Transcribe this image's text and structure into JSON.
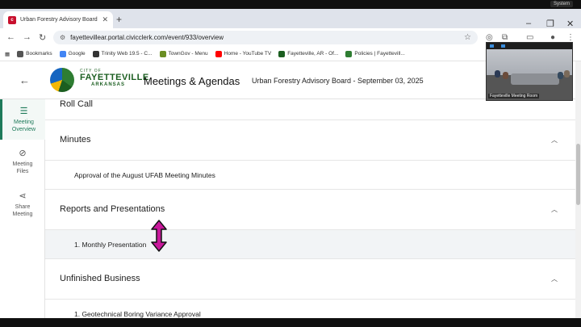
{
  "os": {
    "system_label": "System"
  },
  "browser": {
    "tab_title": "Urban Forestry Advisory Board",
    "url": "fayettevillear.portal.civicclerk.com/event/933/overview",
    "bookmarks": [
      {
        "label": "Bookmarks",
        "color": "#555555"
      },
      {
        "label": "Google",
        "color": "#4285f4"
      },
      {
        "label": "Trinity Web 19.5 - C...",
        "color": "#333333"
      },
      {
        "label": "TownGov - Menu",
        "color": "#6b8e23"
      },
      {
        "label": "Home - YouTube TV",
        "color": "#ff0000"
      },
      {
        "label": "Fayetteville, AR - Of...",
        "color": "#1b5e20"
      },
      {
        "label": "Policies | Fayettevill...",
        "color": "#2e7d32"
      }
    ]
  },
  "header": {
    "city_line1": "CITY OF",
    "city_line2": "FAYETTEVILLE",
    "city_line3": "ARKANSAS",
    "title": "Meetings & Agendas",
    "subtitle": "Urban Forestry Advisory Board - September 03, 2025"
  },
  "sidebar": {
    "items": [
      {
        "label1": "Meeting",
        "label2": "Overview"
      },
      {
        "label1": "Meeting",
        "label2": "Files"
      },
      {
        "label1": "Share",
        "label2": "Meeting"
      }
    ]
  },
  "agenda": {
    "roll_call": "Roll Call",
    "minutes": {
      "title": "Minutes",
      "item": "Approval of the August UFAB Meeting Minutes"
    },
    "reports": {
      "title": "Reports and Presentations",
      "item": "1. Monthly Presentation"
    },
    "unfinished": {
      "title": "Unfinished Business",
      "item": "1. Geotechnical Boring Variance Approval"
    }
  },
  "video": {
    "caption": "Fayetteville Meeting Room"
  },
  "colors": {
    "accent": "#1e7a5a",
    "cursor": "#c8189b"
  }
}
